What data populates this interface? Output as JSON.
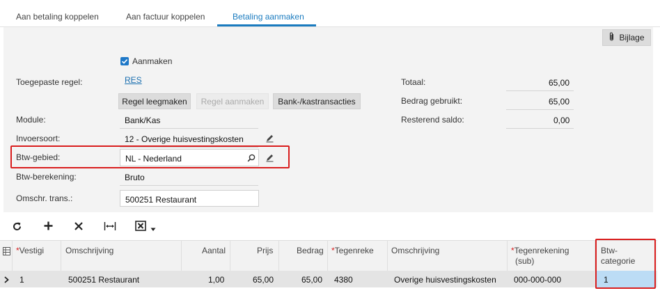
{
  "tabs": [
    {
      "label": "Aan betaling koppelen"
    },
    {
      "label": "Aan factuur koppelen"
    },
    {
      "label": "Betaling aanmaken"
    }
  ],
  "attachment_button": "Bijlage",
  "create_checkbox": {
    "label": "Aanmaken",
    "checked": true
  },
  "form": {
    "applied_rule_label": "Toegepaste regel:",
    "applied_rule_value": "RES",
    "clear_rule_button": "Regel leegmaken",
    "create_rule_button": "Regel aanmaken",
    "bank_transactions_button": "Bank-/kastransacties",
    "module_label": "Module:",
    "module_value": "Bank/Kas",
    "entry_type_label": "Invoersoort:",
    "entry_type_value": "12 - Overige huisvestingskosten",
    "vat_zone_label": "Btw-gebied:",
    "vat_zone_value": "NL - Nederland",
    "vat_calc_label": "Btw-berekening:",
    "vat_calc_value": "Bruto",
    "trans_desc_label": "Omschr. trans.:",
    "trans_desc_value": "500251 Restaurant"
  },
  "totals": {
    "total_label": "Totaal:",
    "total_value": "65,00",
    "used_label": "Bedrag gebruikt:",
    "used_value": "65,00",
    "balance_label": "Resterend saldo:",
    "balance_value": "0,00"
  },
  "toolbar_icons": [
    "refresh-icon",
    "add-icon",
    "delete-icon",
    "fit-columns-icon",
    "excel-export-icon"
  ],
  "grid": {
    "headers": {
      "branch": "Vestigi",
      "description": "Omschrijving",
      "quantity": "Aantal",
      "price": "Prijs",
      "amount": "Bedrag",
      "offset_account": "Tegenreke",
      "description2": "Omschrijving",
      "offset_sub_1": "Tegenrekening",
      "offset_sub_2": "(sub)",
      "vat_cat_1": "Btw-",
      "vat_cat_2": "categorie"
    },
    "row": {
      "branch": "1",
      "description": "500251 Restaurant",
      "quantity": "1,00",
      "price": "65,00",
      "amount": "65,00",
      "offset_account": "4380",
      "description2": "Overige huisvestingskosten",
      "offset_sub": "000-000-000",
      "vat_category": "1"
    }
  },
  "colors": {
    "accent": "#1a7bbf",
    "highlight": "#d91d1d",
    "selected_cell": "#bcdcf5"
  }
}
